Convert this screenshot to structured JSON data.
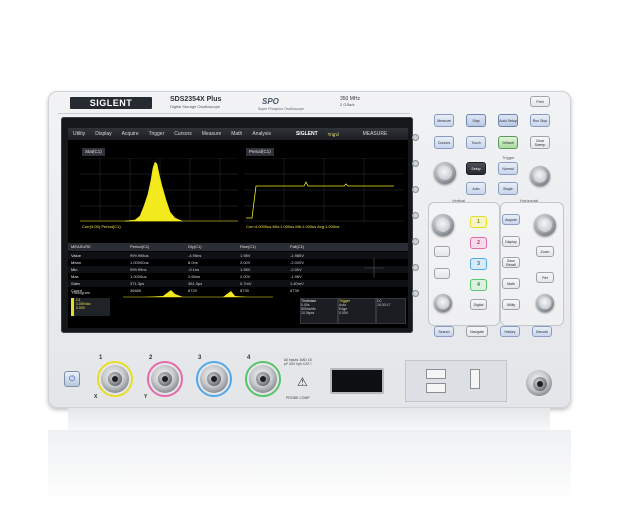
{
  "device": {
    "brand": "SIGLENT",
    "model": "SDS2354X Plus",
    "subtitle": "Digital Storage Oscilloscope",
    "spo_logo": "SPO",
    "spo_subtitle": "Super Phosphor Oscilloscope",
    "bandwidth": "350 MHz",
    "sample_rate": "2 GSa/s"
  },
  "screen": {
    "menu": [
      "Utility",
      "Display",
      "Acquire",
      "Trigger",
      "Cursors",
      "Measure",
      "Math",
      "Analysis"
    ],
    "menu_brand": "SIGLENT",
    "trig_status": "Trig'd",
    "measure_menu": "MEASURE",
    "pane_left_title": "Stat(C1)",
    "pane_right_title": "Period(C1)",
    "pane_left_footer": "Curr(4:00) Period(C1)",
    "pane_right_footer": "Curr:4.0000us  Min:1.000us  Mb:1.000us  Avg:1.000us",
    "stats": {
      "headers": [
        "MEASURE",
        "Period(C1)",
        "Dly(C1)",
        "Rise(C1)",
        "Fall(C1)"
      ],
      "rows": [
        {
          "label": "Value",
          "v": [
            "999.998us",
            "-4.95ns",
            "1.98V",
            "-1.985V"
          ]
        },
        {
          "label": "Mean",
          "v": [
            "1.00000us",
            "8.0ns",
            "2.00V",
            "-2.000V"
          ]
        },
        {
          "label": "Min",
          "v": [
            "999.99ns",
            "-9.1ns",
            "1.98V",
            "-2.00V"
          ]
        },
        {
          "label": "Max",
          "v": [
            "1.0000us",
            "2.68ns",
            "2.00V",
            "-1.98V"
          ]
        },
        {
          "label": "Sdev",
          "v": [
            "371.3ps",
            "361.3ps",
            "0.7mV",
            "1.40mV"
          ]
        },
        {
          "label": "Count",
          "v": [
            "36685",
            "8729",
            "8739",
            "8739"
          ]
        }
      ]
    },
    "histogram_label": "Histogram",
    "ch1_box": {
      "name": "C1",
      "scale": "1.00V/div",
      "offset": "0.00V"
    },
    "timebase_box": {
      "title": "Timebase",
      "delay": "0.00s",
      "scale": "500ns/div",
      "depth": "10.0kpts"
    },
    "trigger_box": {
      "title": "Trigger",
      "mode": "Auto",
      "type": "Edge",
      "coupling": "DC",
      "level": "0.00V"
    },
    "clock": "15:30:17"
  },
  "panel": {
    "buttons_top": [
      "Measure",
      "Stop",
      "Auto Setup",
      "Run Stop"
    ],
    "buttons_row2": [
      "Cursors",
      "Touch",
      "Default",
      "Clear Sweep"
    ],
    "trigger_label": "Trigger",
    "trigger_buttons": [
      "Setup",
      "Auto",
      "Normal",
      "Single"
    ],
    "vertical_label": "Vertical",
    "horizontal_label": "Horizontal",
    "channel_buttons": [
      "1",
      "2",
      "3",
      "4"
    ],
    "function_buttons": [
      "Acquire",
      "Display",
      "Zoom",
      "Save Recall",
      "Math",
      "Ref",
      "Digital",
      "Utility",
      "Print"
    ],
    "bottom_buttons": [
      "Search",
      "Navigate",
      "History",
      "Decode"
    ],
    "ch_inputs": [
      "1",
      "2",
      "3",
      "4"
    ],
    "input_spec": "All inputs 1MΩ 18 pF 400 Vpk CAT I",
    "probe_comp": "PROBE COMP",
    "x_label": "X",
    "y_label": "Y"
  },
  "colors": {
    "ch1": "#e6dd25",
    "ch2": "#e46aa9",
    "ch3": "#53a9e8",
    "ch4": "#57c46a",
    "waveform": "#f2ea1c"
  }
}
